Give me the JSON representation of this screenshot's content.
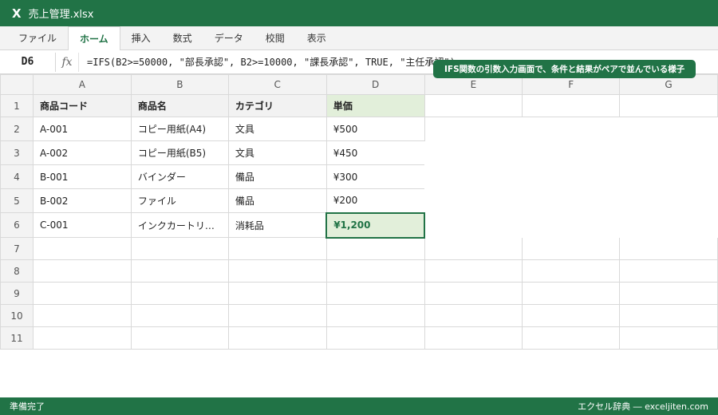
{
  "window": {
    "app_icon": "X",
    "file_name": "売上管理.xlsx"
  },
  "ribbon": {
    "tabs": [
      "ファイル",
      "ホーム",
      "挿入",
      "数式",
      "データ",
      "校閲",
      "表示"
    ],
    "active_tab": "ホーム"
  },
  "formula_bar": {
    "cell_ref": "D6",
    "fx_label": "fx",
    "formula": "=IFS(B2>=50000, \"部長承認\", B2>=10000, \"課長承認\", TRUE, \"主任承認\")"
  },
  "callout": {
    "text": "IFS関数の引数入力画面で、条件と結果がペアで並んでいる様子"
  },
  "sheet": {
    "columns": [
      "A",
      "B",
      "C",
      "D",
      "E",
      "F",
      "G"
    ],
    "rows": [
      {
        "num": "1",
        "cells": [
          "商品コード",
          "商品名",
          "カテゴリ",
          "単価"
        ]
      },
      {
        "num": "2",
        "cells": [
          "A-001",
          "コピー用紙(A4)",
          "文具",
          "¥500"
        ]
      },
      {
        "num": "3",
        "cells": [
          "A-002",
          "コピー用紙(B5)",
          "文具",
          "¥450"
        ]
      },
      {
        "num": "4",
        "cells": [
          "B-001",
          "バインダー",
          "備品",
          "¥300"
        ]
      },
      {
        "num": "5",
        "cells": [
          "B-002",
          "ファイル",
          "備品",
          "¥200"
        ]
      },
      {
        "num": "6",
        "cells": [
          "C-001",
          "インクカートリ…",
          "消耗品",
          "¥1,200"
        ]
      },
      {
        "num": "7",
        "cells": []
      },
      {
        "num": "8",
        "cells": []
      },
      {
        "num": "9",
        "cells": []
      },
      {
        "num": "10",
        "cells": []
      },
      {
        "num": "11",
        "cells": []
      }
    ],
    "selected_cell": "D6"
  },
  "status": {
    "left": "準備完了",
    "right": "エクセル辞典 ― exceljiten.com"
  },
  "colors": {
    "accent": "#217346",
    "selected_fill": "#e2efda",
    "header_fill": "#f3f3f3"
  }
}
